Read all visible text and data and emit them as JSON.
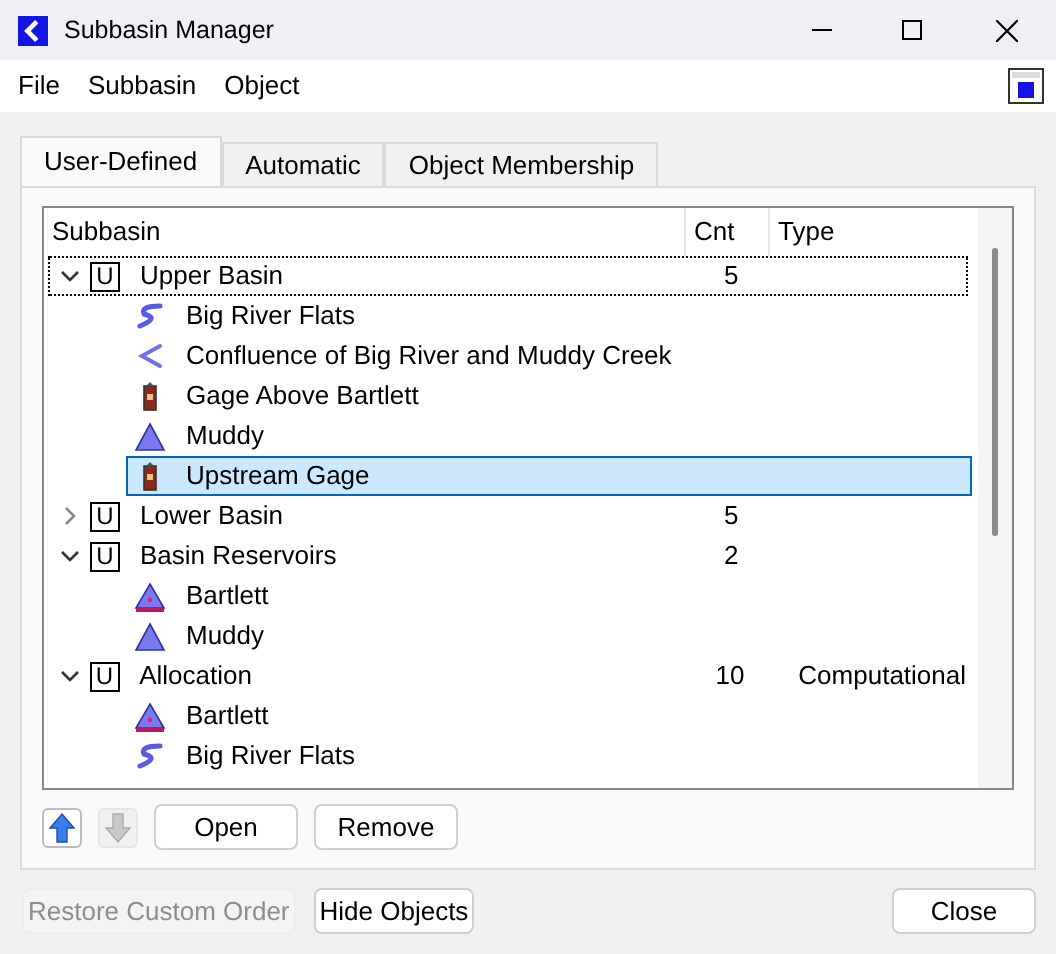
{
  "window": {
    "title": "Subbasin Manager"
  },
  "menu": [
    "File",
    "Subbasin",
    "Object"
  ],
  "tabs": [
    {
      "label": "User-Defined",
      "selected": true
    },
    {
      "label": "Automatic",
      "selected": false
    },
    {
      "label": "Object Membership",
      "selected": false
    }
  ],
  "tree": {
    "columns": [
      "Subbasin",
      "Cnt",
      "Type"
    ],
    "groups": [
      {
        "badge": "U",
        "name": "Upper Basin",
        "count": "5",
        "expanded": true,
        "focused": true,
        "children": [
          {
            "kind": "reach",
            "name": "Big River Flats",
            "selected": false
          },
          {
            "kind": "confluence",
            "name": "Confluence of Big River and Muddy Creek",
            "selected": false
          },
          {
            "kind": "gage",
            "name": "Gage Above Bartlett",
            "selected": false
          },
          {
            "kind": "reservoir",
            "name": "Muddy",
            "selected": false
          },
          {
            "kind": "gage",
            "name": "Upstream Gage",
            "selected": true
          }
        ]
      },
      {
        "badge": "U",
        "name": "Lower Basin",
        "count": "5",
        "expanded": false,
        "focused": false
      },
      {
        "badge": "U",
        "name": "Basin Reservoirs",
        "count": "2",
        "expanded": true,
        "focused": false,
        "children": [
          {
            "kind": "power-reservoir",
            "name": "Bartlett",
            "selected": false
          },
          {
            "kind": "storage-reservoir",
            "name": "Muddy",
            "selected": false
          }
        ]
      },
      {
        "badge": "U",
        "name": "Allocation",
        "count": "10",
        "type": "Computational",
        "expanded": true,
        "focused": false,
        "children": [
          {
            "kind": "power-reservoir",
            "name": "Bartlett",
            "selected": false
          },
          {
            "kind": "reach",
            "name": "Big River Flats",
            "selected": false
          }
        ]
      }
    ]
  },
  "move_buttons": [
    {
      "kind": "up",
      "disabled": false
    },
    {
      "kind": "down",
      "disabled": true
    }
  ],
  "panel_buttons": [
    "Open",
    "Remove"
  ],
  "footer_buttons": [
    {
      "label": "Restore Custom Order",
      "disabled": true
    },
    {
      "label": "Hide Objects",
      "disabled": false
    }
  ],
  "close_button": "Close"
}
